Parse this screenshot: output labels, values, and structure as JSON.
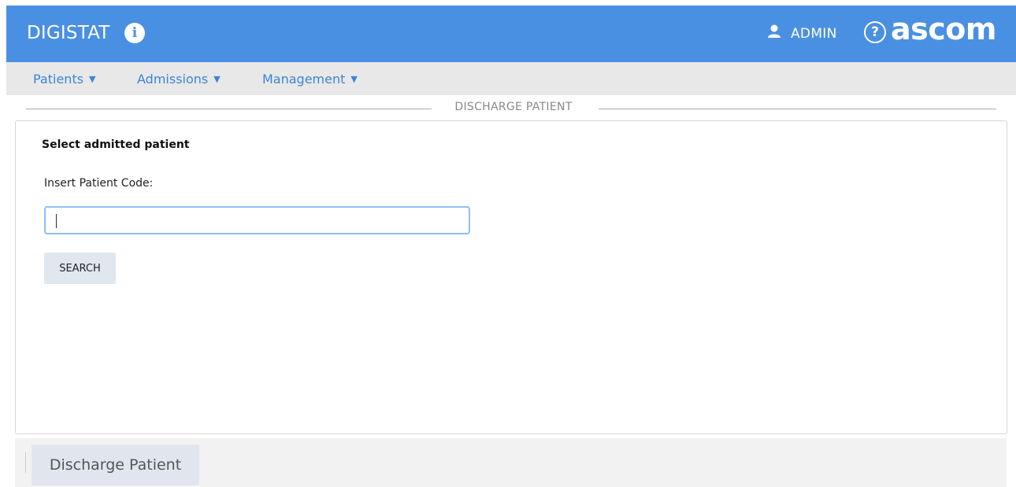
{
  "header": {
    "brand": "DIGISTAT",
    "user": "ADMIN",
    "logo": "ascom",
    "icons": {
      "info": "info-icon",
      "user": "user-icon",
      "help": "help-icon"
    },
    "colors": {
      "header_bg": "#4a90e2",
      "menu_link": "#3a85d6"
    }
  },
  "menu": {
    "items": [
      {
        "label": "Patients"
      },
      {
        "label": "Admissions"
      },
      {
        "label": "Management"
      }
    ]
  },
  "section": {
    "title": "DISCHARGE PATIENT"
  },
  "form": {
    "heading": "Select admitted patient",
    "field_label": "Insert Patient Code:",
    "input_value": "",
    "search_label": "SEARCH"
  },
  "footer": {
    "tab_label": "Discharge Patient"
  }
}
